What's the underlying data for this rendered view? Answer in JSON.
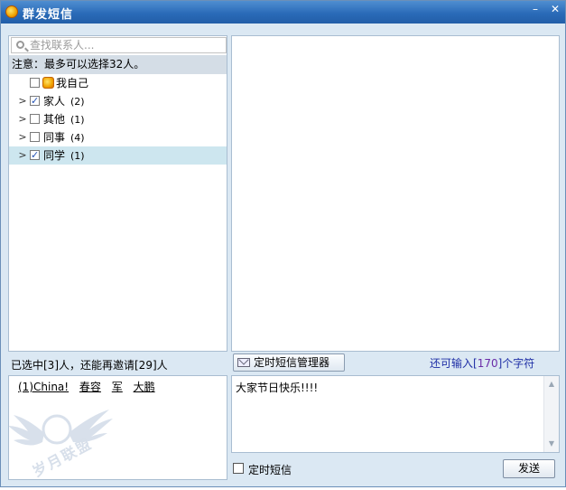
{
  "window": {
    "title": "群发短信",
    "minimize_glyph": "–",
    "close_glyph": "✕"
  },
  "contacts": {
    "search_placeholder": "查找联系人...",
    "notice": "注意：最多可以选择32人。",
    "items": [
      {
        "label": "我自己",
        "count": "",
        "checked": false,
        "expandable": false
      },
      {
        "label": "家人",
        "count": "(2)",
        "checked": true,
        "expandable": true
      },
      {
        "label": "其他",
        "count": "(1)",
        "checked": false,
        "expandable": true
      },
      {
        "label": "同事",
        "count": "(4)",
        "checked": false,
        "expandable": true
      },
      {
        "label": "同学",
        "count": "(1)",
        "checked": true,
        "expandable": true,
        "selected": true
      }
    ]
  },
  "selection": {
    "summary": "已选中[3]人，还能再邀请[29]人",
    "selected": [
      "(1)China!",
      "春容",
      "军",
      "大鹏"
    ]
  },
  "compose": {
    "schedule_manager_label": "定时短信管理器",
    "remaining_prefix": "还可输入[",
    "remaining_count": "170",
    "remaining_suffix": "]个字符",
    "message": "大家节日快乐!!!!",
    "timed_label": "定时短信",
    "timed_checked": false,
    "send_label": "发送"
  },
  "watermark": {
    "brand": "岁月联盟"
  }
}
